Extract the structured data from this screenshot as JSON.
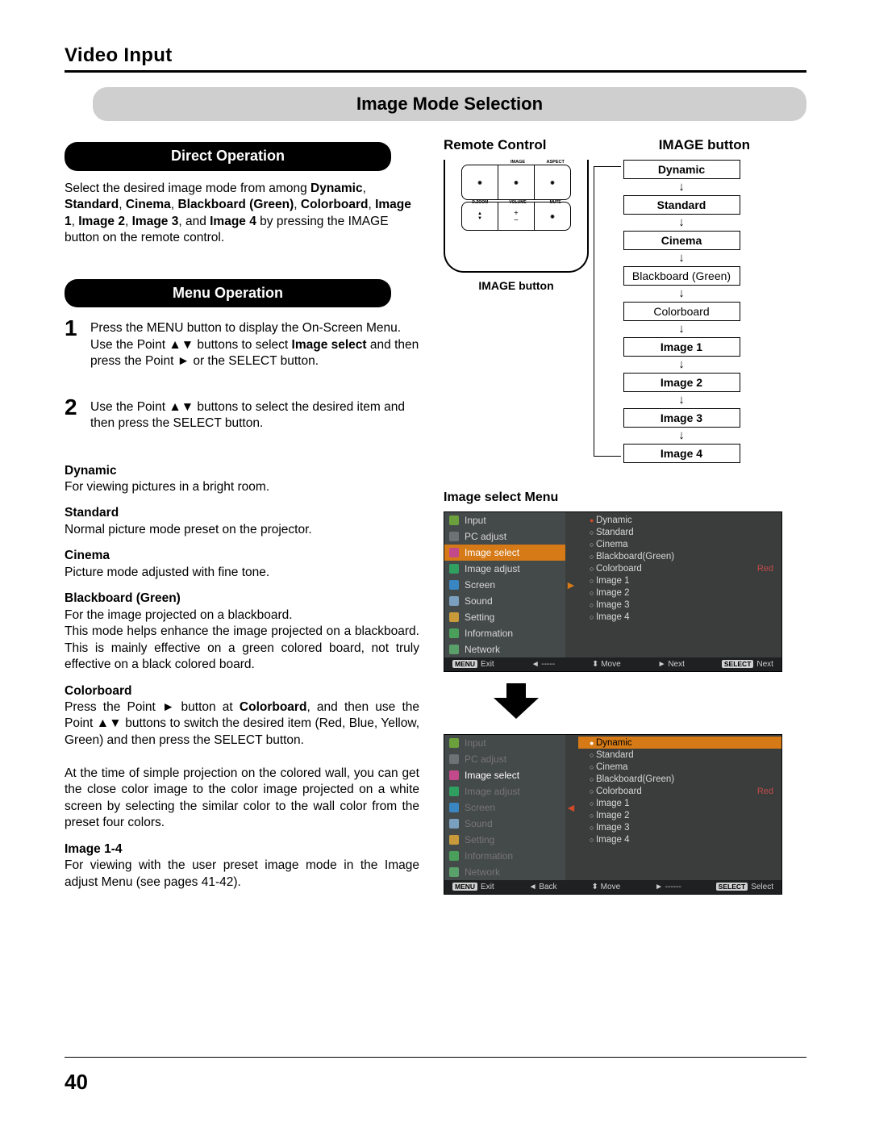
{
  "section_title": "Video Input",
  "banner": "Image Mode Selection",
  "pills": {
    "direct": "Direct Operation",
    "menu": "Menu Operation"
  },
  "direct_text": "Select the desired image mode from among Dynamic, Standard, Cinema, Blackboard (Green), Colorboard, Image 1, Image 2, Image 3, and Image 4 by pressing the IMAGE button on the remote control.",
  "steps": [
    {
      "n": "1",
      "text": "Press the MENU button to display the On-Screen Menu. Use the Point ▲▼ buttons to select Image select and then press the Point ► or the SELECT button."
    },
    {
      "n": "2",
      "text": "Use the Point ▲▼ buttons to select the desired item and then press the SELECT button."
    }
  ],
  "modes": [
    {
      "label": "Dynamic",
      "desc": "For viewing pictures in a bright room."
    },
    {
      "label": "Standard",
      "desc": "Normal picture mode preset on the projector."
    },
    {
      "label": "Cinema",
      "desc": "Picture mode adjusted with fine tone."
    },
    {
      "label": "Blackboard (Green)",
      "desc": "For the image projected on a blackboard.\nThis mode helps enhance the image projected on a blackboard. This is mainly effective on a green colored board, not truly effective on a black colored board."
    },
    {
      "label": "Colorboard",
      "desc": "Press the Point ► button at Colorboard, and then use the Point ▲▼ buttons to switch the desired item (Red, Blue, Yellow, Green) and then press the SELECT button.\nAt the time of simple projection on the colored wall, you can get the close color image to the color image projected on a white screen by selecting the similar color to the wall color from the preset four colors."
    },
    {
      "label": "Image 1-4",
      "desc": "For viewing with the user preset image mode in the Image adjust Menu (see pages 41-42)."
    }
  ],
  "rc": {
    "heading": "Remote Control",
    "img_button": "IMAGE button",
    "flow_title": "IMAGE button",
    "flow": [
      "Dynamic",
      "Standard",
      "Cinema",
      "Blackboard (Green)",
      "Colorboard",
      "Image 1",
      "Image 2",
      "Image 3",
      "Image 4"
    ],
    "remote_top": [
      "",
      "IMAGE",
      "ASPECT"
    ],
    "remote_bottom": [
      "D.ZOOM",
      "VOLUME",
      "MUTE"
    ]
  },
  "menu": {
    "heading": "Image select Menu",
    "sidebar": [
      "Input",
      "PC adjust",
      "Image select",
      "Image adjust",
      "Screen",
      "Sound",
      "Setting",
      "Information",
      "Network"
    ],
    "options": [
      "Dynamic",
      "Standard",
      "Cinema",
      "Blackboard(Green)",
      "Colorboard",
      "Image 1",
      "Image 2",
      "Image 3",
      "Image 4"
    ],
    "color_label": "Red",
    "foot1": {
      "exit": "Exit",
      "back": "-----",
      "move": "Move",
      "next": "Next",
      "select": "Next"
    },
    "foot2": {
      "exit": "Exit",
      "back": "Back",
      "move": "Move",
      "next": "------",
      "select": "Select"
    },
    "btn_menu": "MENU",
    "btn_select": "SELECT"
  },
  "pagenum": "40"
}
